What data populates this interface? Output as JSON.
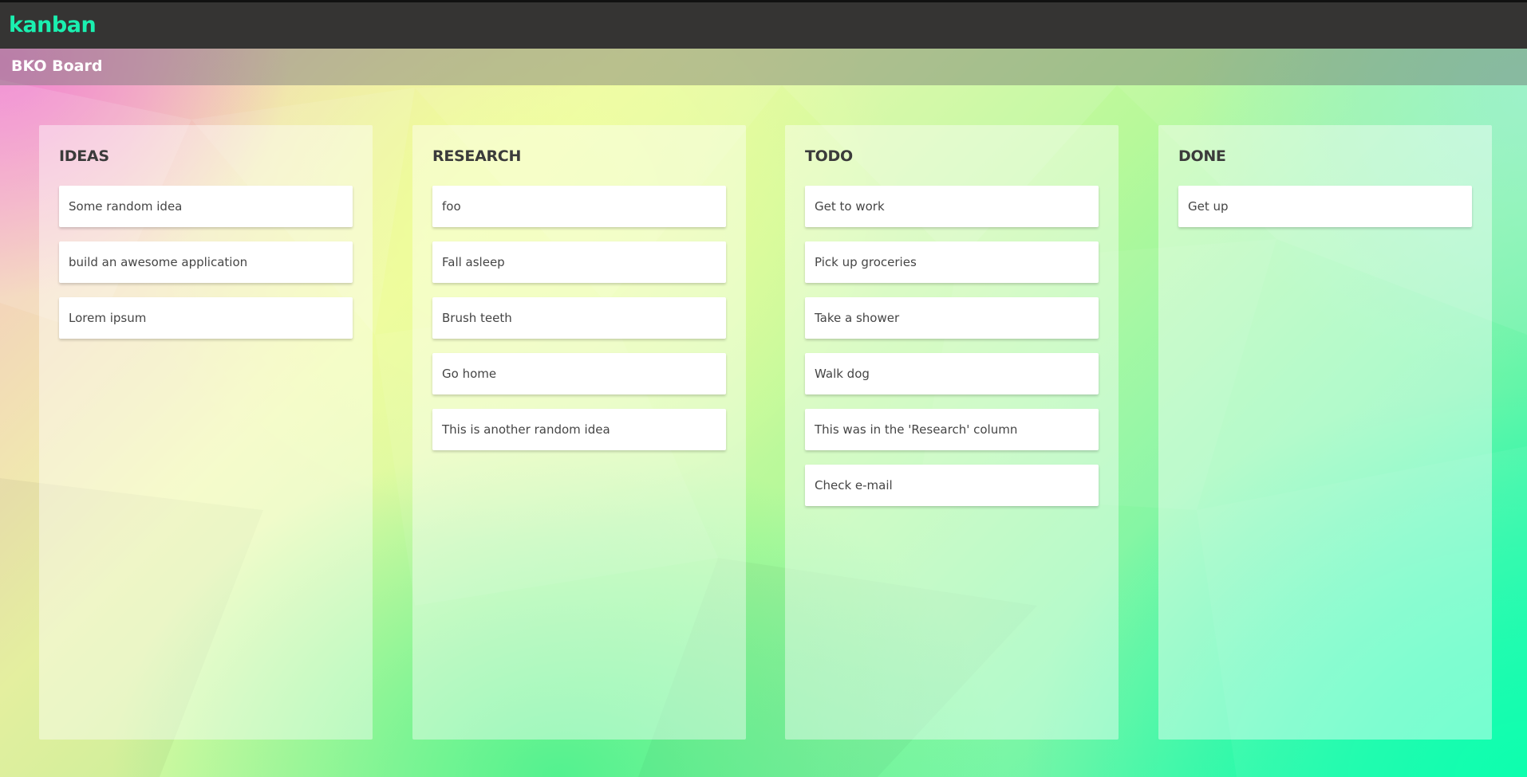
{
  "app": {
    "brand": "kanban",
    "accent_color": "#1af0b0",
    "topbar_color": "#353433"
  },
  "board": {
    "title": "BKO Board"
  },
  "columns": [
    {
      "title": "IDEAS",
      "cards": [
        "Some random idea",
        "build an awesome application",
        "Lorem ipsum"
      ]
    },
    {
      "title": "RESEARCH",
      "cards": [
        "foo",
        "Fall asleep",
        "Brush teeth",
        "Go home",
        "This is another random idea"
      ]
    },
    {
      "title": "TODO",
      "cards": [
        "Get to work",
        "Pick up groceries",
        "Take a shower",
        "Walk dog",
        "This was in the 'Research' column",
        "Check e-mail"
      ]
    },
    {
      "title": "DONE",
      "cards": [
        "Get up"
      ]
    }
  ]
}
